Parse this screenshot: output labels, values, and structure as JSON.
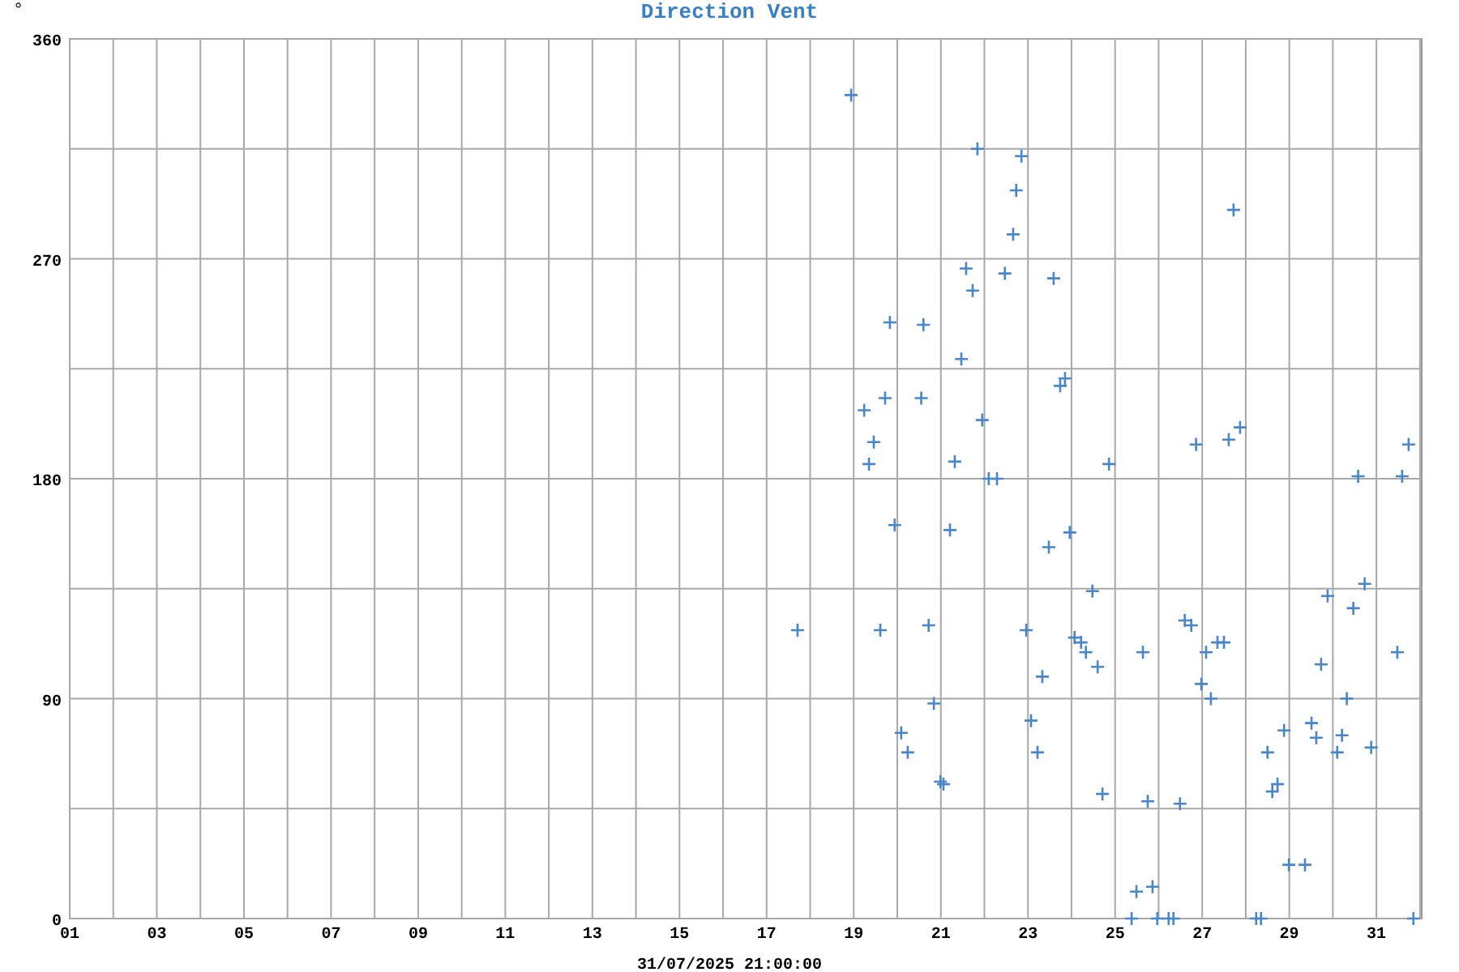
{
  "chart_data": {
    "type": "scatter",
    "title": "Direction Vent",
    "ylabel": "°",
    "xlabel": "31/07/2025 21:00:00",
    "xlim": [
      1,
      32.04
    ],
    "ylim": [
      0,
      360
    ],
    "xticks": [
      {
        "value": 1,
        "label": "01"
      },
      {
        "value": 3,
        "label": "03"
      },
      {
        "value": 5,
        "label": "05"
      },
      {
        "value": 7,
        "label": "07"
      },
      {
        "value": 9,
        "label": "09"
      },
      {
        "value": 11,
        "label": "11"
      },
      {
        "value": 13,
        "label": "13"
      },
      {
        "value": 15,
        "label": "15"
      },
      {
        "value": 17,
        "label": "17"
      },
      {
        "value": 19,
        "label": "19"
      },
      {
        "value": 21,
        "label": "21"
      },
      {
        "value": 23,
        "label": "23"
      },
      {
        "value": 25,
        "label": "25"
      },
      {
        "value": 27,
        "label": "27"
      },
      {
        "value": 29,
        "label": "29"
      },
      {
        "value": 31,
        "label": "31"
      }
    ],
    "yticks": [
      0,
      90,
      180,
      270,
      360
    ],
    "grid": true,
    "series": [
      {
        "color": "#4a86c5",
        "x": [
          17.71,
          18.94,
          19.24,
          19.35,
          19.46,
          19.61,
          19.72,
          19.83,
          19.94,
          20.09,
          20.24,
          20.55,
          20.6,
          20.72,
          20.84,
          20.99,
          21.06,
          21.21,
          21.32,
          21.47,
          21.58,
          21.73,
          21.84,
          21.95,
          22.1,
          22.29,
          22.47,
          22.66,
          22.73,
          22.85,
          22.96,
          23.07,
          23.22,
          23.33,
          23.48,
          23.59,
          23.74,
          23.85,
          23.96,
          24.07,
          24.22,
          24.33,
          24.48,
          24.6,
          24.71,
          24.86,
          25.38,
          25.49,
          25.64,
          25.75,
          25.86,
          25.97,
          26.23,
          26.34,
          26.49,
          26.6,
          26.75,
          26.86,
          26.98,
          27.09,
          27.2,
          27.35,
          27.5,
          27.61,
          27.72,
          27.87,
          28.24,
          28.35,
          28.5,
          28.61,
          28.73,
          28.88,
          28.99,
          29.36,
          29.51,
          29.62,
          29.73,
          29.88,
          30.1,
          30.21,
          30.32,
          30.47,
          30.58,
          30.73,
          30.88,
          31.48,
          31.59,
          31.74,
          31.85
        ],
        "values": [
          118,
          337,
          208,
          186,
          195,
          118,
          213,
          244,
          161,
          76,
          68,
          213,
          243,
          120,
          88,
          56,
          55,
          159,
          187,
          229,
          266,
          257,
          315,
          204,
          180,
          180,
          264,
          280,
          298,
          312,
          118,
          81,
          68,
          99,
          152,
          262,
          218,
          221,
          158,
          115,
          113,
          109,
          134,
          103,
          51,
          186,
          0,
          11,
          109,
          48,
          13,
          0,
          0,
          0,
          47,
          122,
          120,
          194,
          96,
          109,
          90,
          113,
          113,
          196,
          290,
          201,
          0,
          0,
          68,
          52,
          55,
          77,
          22,
          22,
          80,
          74,
          104,
          132,
          68,
          75,
          90,
          127,
          181,
          137,
          70,
          109,
          181,
          194,
          0
        ]
      }
    ]
  }
}
